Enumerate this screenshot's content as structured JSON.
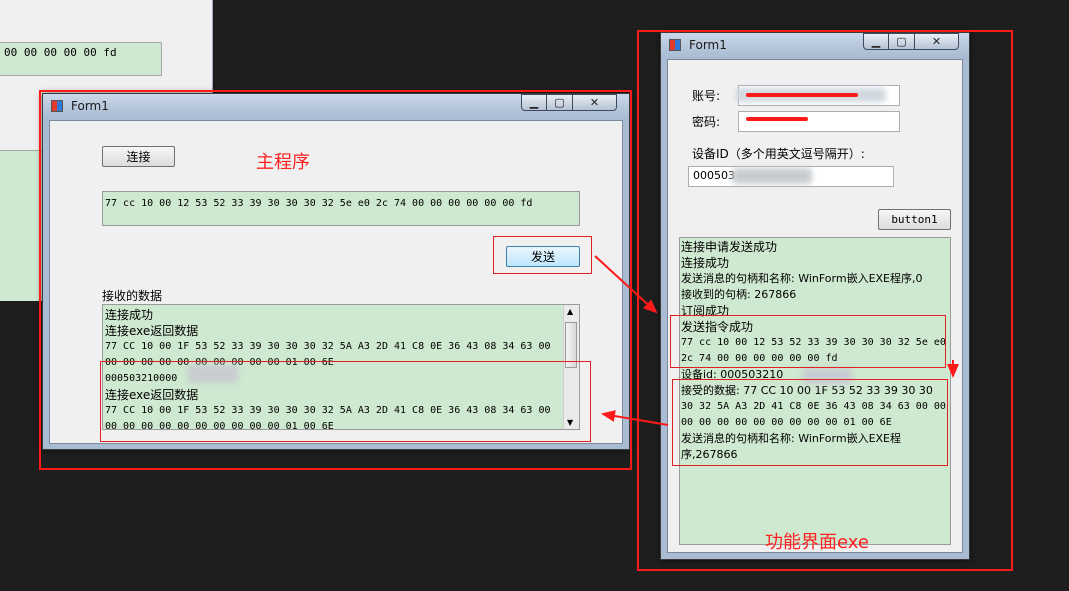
{
  "bg_window": {
    "hex_text": "00 00 00 00 00 fd"
  },
  "main_window": {
    "title": "Form1",
    "controls": {
      "min": "▁",
      "max": "▢",
      "close": "✕"
    },
    "connect_label": "连接",
    "send_label": "发送",
    "send_hex": "77 cc 10 00 12 53 52 33 39 30 30 30 32 5e e0 2c 74 00 00 00 00 00 00 fd",
    "received_label": "接收的数据",
    "received_lines": [
      "连接成功",
      "连接exe返回数据",
      "77 CC 10 00 1F 53 52 33 39 30 30 30 32 5A A3 2D 41 C8 0E 36 43 08 34 63 00",
      "00 00 00 00 00 00 00 00 00 00 01 00 6E",
      "000503210000",
      "连接exe返回数据",
      "77 CC 10 00 1F 53 52 33 39 30 30 30 32 5A A3 2D 41 C8 0E 36 43 08 34 63 00",
      "00 00 00 00 00 00 00 00 00 00 01 00 6E"
    ],
    "annotation": "主程序"
  },
  "exe_window": {
    "title": "Form1",
    "account_label": "账号:",
    "password_label": "密码:",
    "device_label": "设备ID（多个用英文逗号隔开）:",
    "device_value": "000503",
    "button1_label": "button1",
    "log_lines": [
      "连接申请发送成功",
      "连接成功",
      "发送消息的句柄和名称: WinForm嵌入EXE程序,0",
      "接收到的句柄: 267866",
      "订阅成功",
      "发送指令成功",
      "77 cc 10 00 12 53 52 33 39 30 30 30 32 5e e0",
      "2c 74 00 00 00 00 00 00 fd",
      "设备id: 000503210",
      "接受的数据: 77 CC 10 00 1F 53 52 33 39 30 30",
      "30 32 5A A3 2D 41 C8 0E 36 43 08 34 63 00 00",
      "00 00 00 00 00 00 00 00 00 01 00 6E",
      "发送消息的句柄和名称: WinForm嵌入EXE程",
      "序,267866"
    ],
    "annotation": "功能界面exe"
  },
  "colors": {
    "annotation_red": "#ff1a1a",
    "log_green": "#cfe8d0",
    "window_frame": "#a9bcd3"
  }
}
